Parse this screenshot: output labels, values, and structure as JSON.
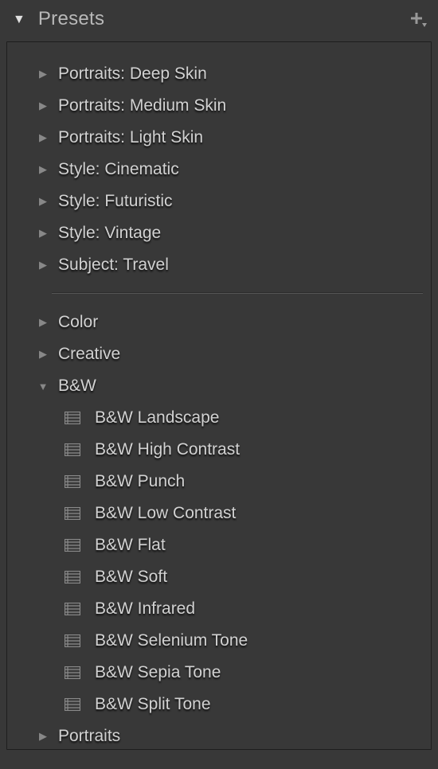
{
  "panel": {
    "title": "Presets"
  },
  "groups_top": [
    {
      "label": "Portraits: Deep Skin"
    },
    {
      "label": "Portraits: Medium Skin"
    },
    {
      "label": "Portraits: Light Skin"
    },
    {
      "label": "Style: Cinematic"
    },
    {
      "label": "Style: Futuristic"
    },
    {
      "label": "Style: Vintage"
    },
    {
      "label": "Subject: Travel"
    }
  ],
  "groups_bottom": [
    {
      "label": "Color",
      "expanded": false
    },
    {
      "label": "Creative",
      "expanded": false
    },
    {
      "label": "B&W",
      "expanded": true
    },
    {
      "label": "Portraits",
      "expanded": false
    }
  ],
  "bw_presets": [
    {
      "label": "B&W Landscape"
    },
    {
      "label": "B&W High Contrast"
    },
    {
      "label": "B&W Punch"
    },
    {
      "label": "B&W Low Contrast"
    },
    {
      "label": "B&W Flat"
    },
    {
      "label": "B&W Soft"
    },
    {
      "label": "B&W Infrared"
    },
    {
      "label": "B&W Selenium Tone"
    },
    {
      "label": "B&W Sepia Tone"
    },
    {
      "label": "B&W Split Tone"
    }
  ]
}
